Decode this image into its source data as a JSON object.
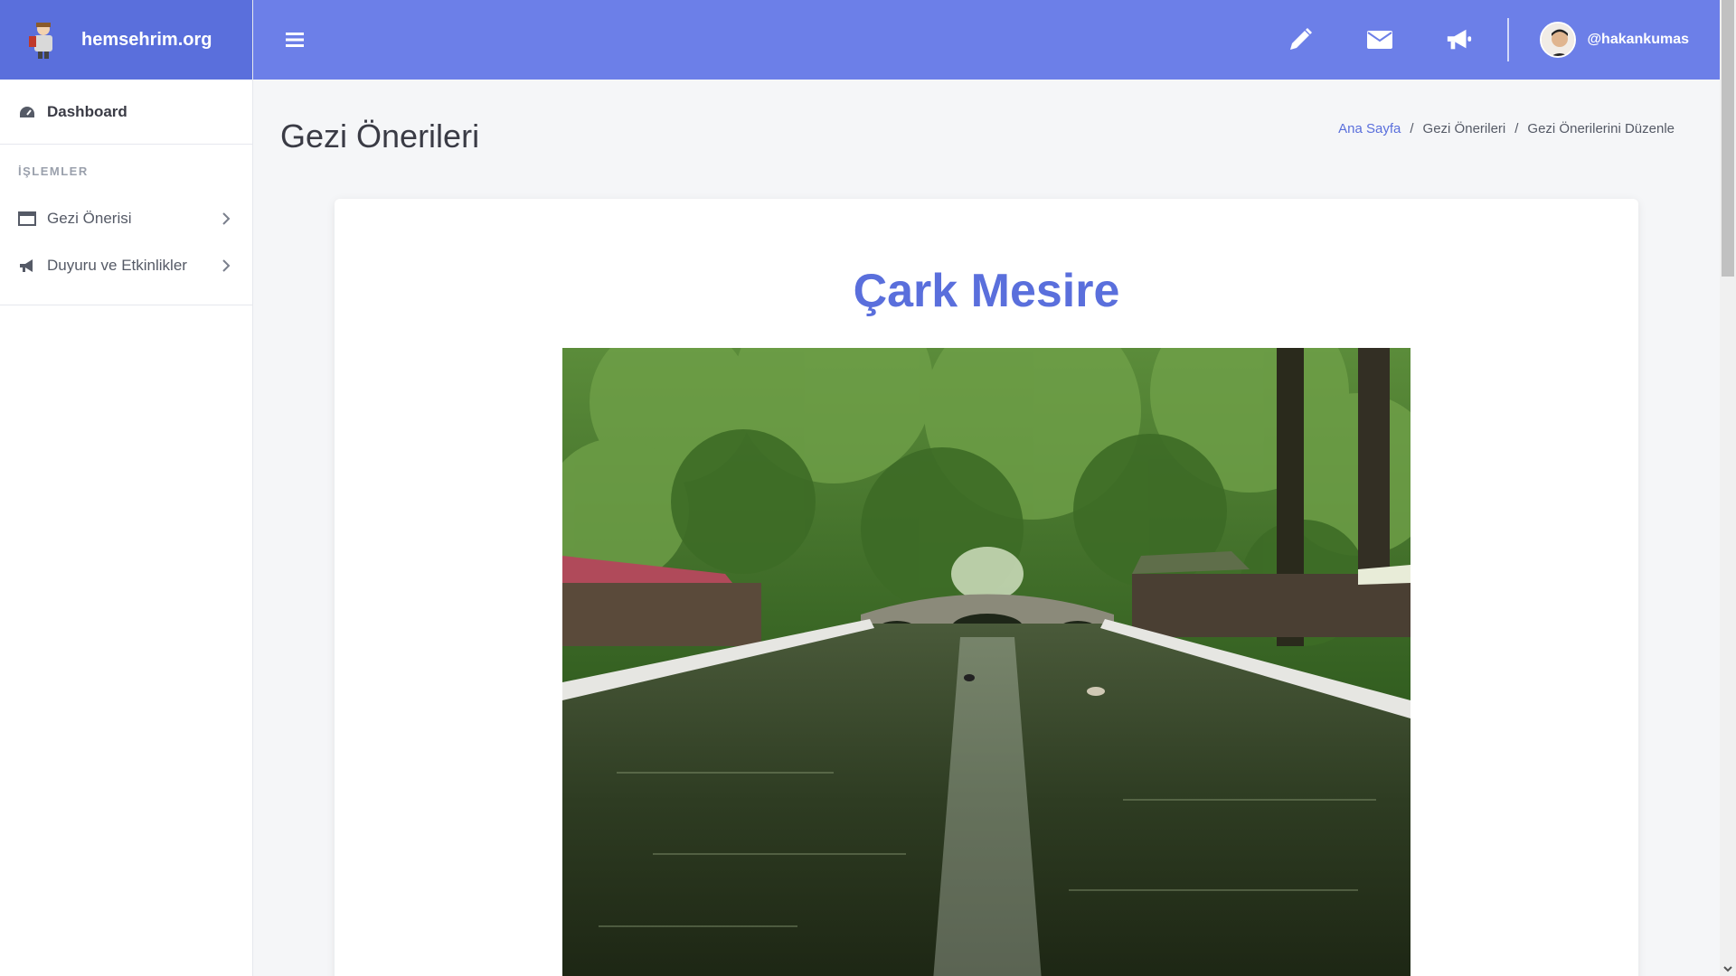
{
  "brand": {
    "name": "hemsehrim.org"
  },
  "sidebar": {
    "dashboard_label": "Dashboard",
    "section_heading": "İŞLEMLER",
    "items": [
      {
        "label": "Gezi Önerisi",
        "icon": "window-icon"
      },
      {
        "label": "Duyuru ve Etkinlikler",
        "icon": "megaphone-icon"
      }
    ]
  },
  "topbar": {
    "icons": [
      "pencil-icon",
      "envelope-icon",
      "megaphone-icon"
    ],
    "username": "@hakankumas"
  },
  "page": {
    "title": "Gezi Önerileri",
    "breadcrumb": {
      "home": "Ana Sayfa",
      "sep": "/",
      "section": "Gezi Önerileri",
      "current": "Gezi Önerilerini Düzenle"
    }
  },
  "card": {
    "title": "Çark Mesire"
  },
  "colors": {
    "accent": "#6c7fe8",
    "brand_bg": "#5a6fdc",
    "title": "#5a6fdc"
  }
}
